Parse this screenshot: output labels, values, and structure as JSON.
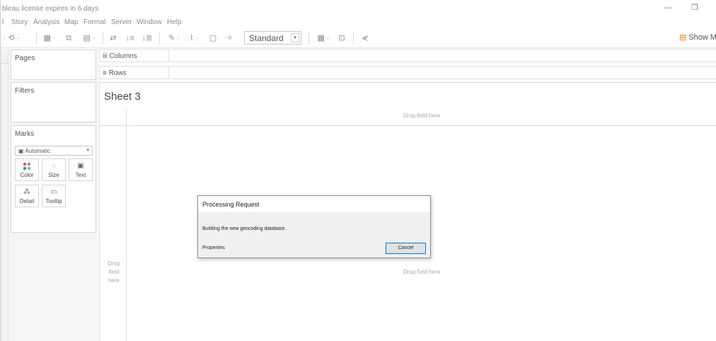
{
  "app": {
    "license_notice": "bleau license expires in 6 days",
    "window_controls": {
      "minimize": "—",
      "restore": "❐"
    }
  },
  "menu": {
    "items": [
      "l",
      "Story",
      "Analysis",
      "Map",
      "Format",
      "Server",
      "Window",
      "Help"
    ]
  },
  "toolbar": {
    "mark_type_standard": "Standard",
    "show_me": "Show M",
    "icons": [
      "undo-icon",
      "new-datasource-icon",
      "duplicate-sheet-icon",
      "clear-sheet-icon",
      "swap-icon",
      "sort-asc-icon",
      "sort-desc-icon",
      "highlight-icon",
      "group-icon",
      "label-icon",
      "pin-icon",
      "fit-icon",
      "presentation-icon",
      "share-icon"
    ]
  },
  "cards": {
    "pages": "Pages",
    "filters": "Filters",
    "marks": "Marks",
    "mark_type": "Automatic",
    "mark_buttons": {
      "color": "Color",
      "size": "Size",
      "text": "Text",
      "detail": "Detail",
      "tooltip": "Tooltip"
    }
  },
  "shelves": {
    "columns": "Columns",
    "rows": "Rows"
  },
  "view": {
    "sheet_title": "Sheet 3",
    "drop_top": "Drop field here",
    "drop_middle": "Drop field here",
    "drop_left": "Drop field here"
  },
  "dialog": {
    "title": "Processing Request",
    "message": "Building the new geocoding database.",
    "properties": "Properties",
    "cancel": "Cancel"
  },
  "colors": {
    "accent": "#0078d7",
    "showme_icon": "#e87f2a",
    "color_dots": [
      "#e15759",
      "#4e79a7",
      "#b07aa1",
      "#76b7b2"
    ]
  }
}
